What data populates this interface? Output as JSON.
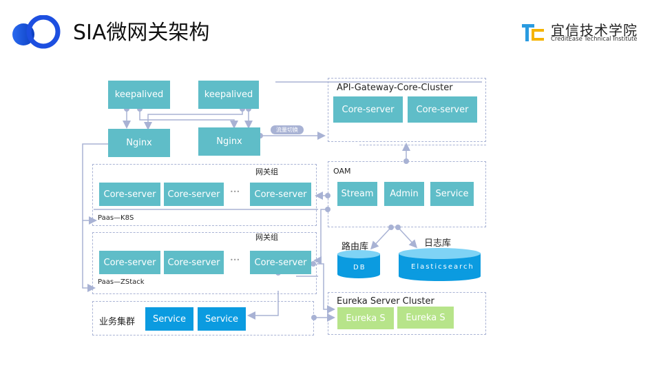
{
  "header": {
    "title": "SIA微网关架构",
    "brand_cn": "宜信技术学院",
    "brand_en": "CreditEase Technical Institute",
    "logo_icon": "sia-logo-icon",
    "brand_icon": "tc-logo-icon"
  },
  "diagram": {
    "keepalived": [
      "keepalived",
      "keepalived"
    ],
    "nginx": [
      "Nginx",
      "Nginx"
    ],
    "traffic_switch_tag": "流量切换",
    "api_cluster": {
      "title": "API-Gateway-Core-Cluster",
      "servers": [
        "Core-server",
        "Core-server"
      ]
    },
    "gateway_group_1": {
      "title": "网关组",
      "servers": [
        "Core-server",
        "Core-server",
        "Core-server"
      ],
      "ellipsis": "•••",
      "platform": "Paas—K8S"
    },
    "gateway_group_2": {
      "title": "网关组",
      "servers": [
        "Core-server",
        "Core-server",
        "Core-server"
      ],
      "ellipsis": "•••",
      "platform": "Paas—ZStack"
    },
    "oam": {
      "title": "OAM",
      "items": [
        "Stream",
        "Admin",
        "Service"
      ]
    },
    "route_db": {
      "label": "路由库",
      "name": "DB"
    },
    "log_db": {
      "label": "日志库",
      "name": "Elasticsearch"
    },
    "business_cluster": {
      "title": "业务集群",
      "services": [
        "Service",
        "Service"
      ]
    },
    "eureka": {
      "title": "Eureka Server Cluster",
      "servers": [
        "Eureka S",
        "Eureka S"
      ]
    }
  }
}
